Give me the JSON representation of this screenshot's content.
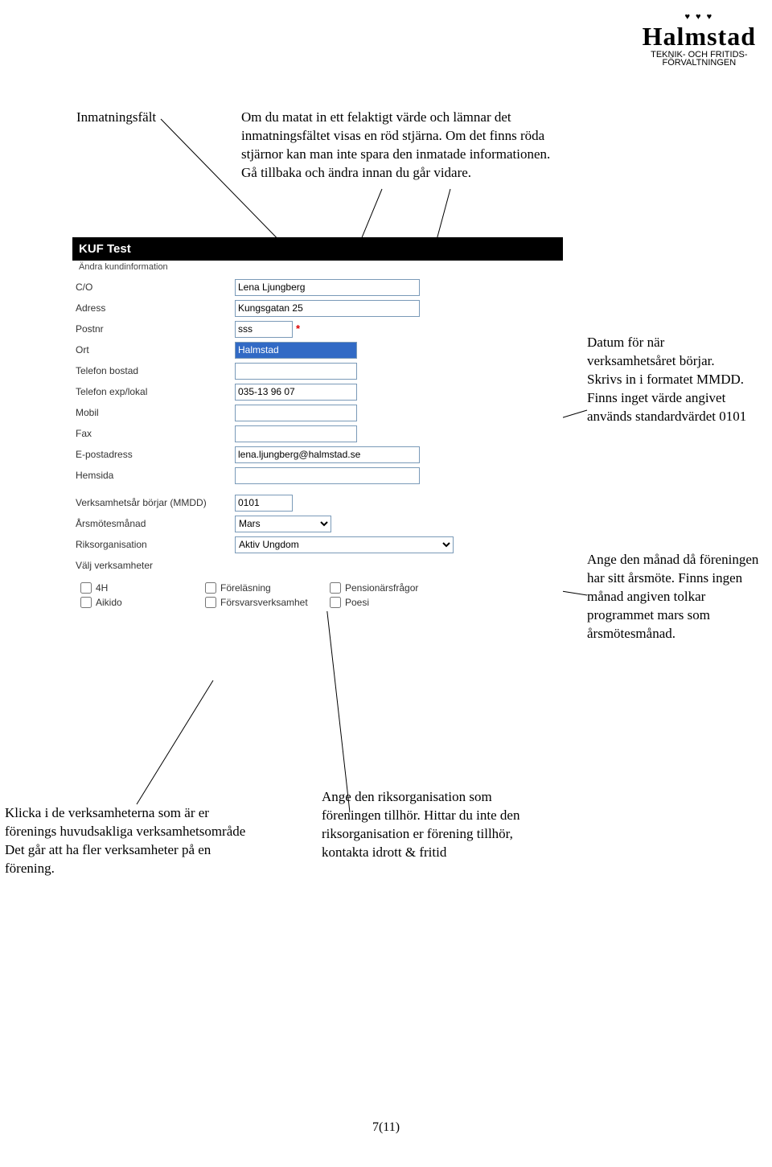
{
  "logo": {
    "crown": "♥ ♥ ♥",
    "name": "Halmstad",
    "dept_line1": "TEKNIK- OCH FRITIDS-",
    "dept_line2": "FÖRVALTNINGEN"
  },
  "callouts": {
    "inmatningsfalt": "Inmatningsfält",
    "c1": "Om du matat in ett felaktigt värde och lämnar det inmatningsfältet visas en röd stjärna. Om det finns röda stjärnor kan man inte spara den inmatade informationen. Gå tillbaka och ändra innan du går vidare.",
    "c2": "Datum för när verksamhetsåret börjar. Skrivs in i formatet MMDD. Finns inget värde angivet används standardvärdet 0101",
    "c3": "Ange den månad då föreningen har sitt årsmöte. Finns ingen månad angiven tolkar programmet mars som årsmötesmånad.",
    "c4": "Ange den riksorganisation som föreningen tillhör. Hittar du inte den riksorganisation er förening tillhör, kontakta idrott & fritid",
    "c5": "Klicka i de verksamheterna som är er förenings huvudsakliga verksamhetsområde Det går att ha fler verksamheter på en förening."
  },
  "form": {
    "title": "KUF Test",
    "subtitle": "Ändra kundinformation",
    "labels": {
      "co": "C/O",
      "adress": "Adress",
      "postnr": "Postnr",
      "ort": "Ort",
      "tel_b": "Telefon bostad",
      "tel_e": "Telefon exp/lokal",
      "mobil": "Mobil",
      "fax": "Fax",
      "epost": "E-postadress",
      "hemsida": "Hemsida",
      "vstart": "Verksamhetsår börjar (MMDD)",
      "arsmote": "Årsmötesmånad",
      "riksorg": "Riksorganisation",
      "valj": "Välj verksamheter"
    },
    "values": {
      "co": "Lena Ljungberg",
      "adress": "Kungsgatan 25",
      "postnr": "sss",
      "ort": "Halmstad",
      "tel_b": "",
      "tel_e": "035-13 96 07",
      "mobil": "",
      "fax": "",
      "epost": "lena.ljungberg@halmstad.se",
      "hemsida": "",
      "vstart": "0101",
      "arsmote": "Mars",
      "riksorg": "Aktiv Ungdom"
    },
    "star": "*",
    "verksamheter_col1": [
      "4H",
      "Aikido"
    ],
    "verksamheter_col2": [
      "Föreläsning",
      "Försvarsverksamhet"
    ],
    "verksamheter_col3": [
      "Pensionärsfrågor",
      "Poesi"
    ]
  },
  "pagenum": "7(11)"
}
